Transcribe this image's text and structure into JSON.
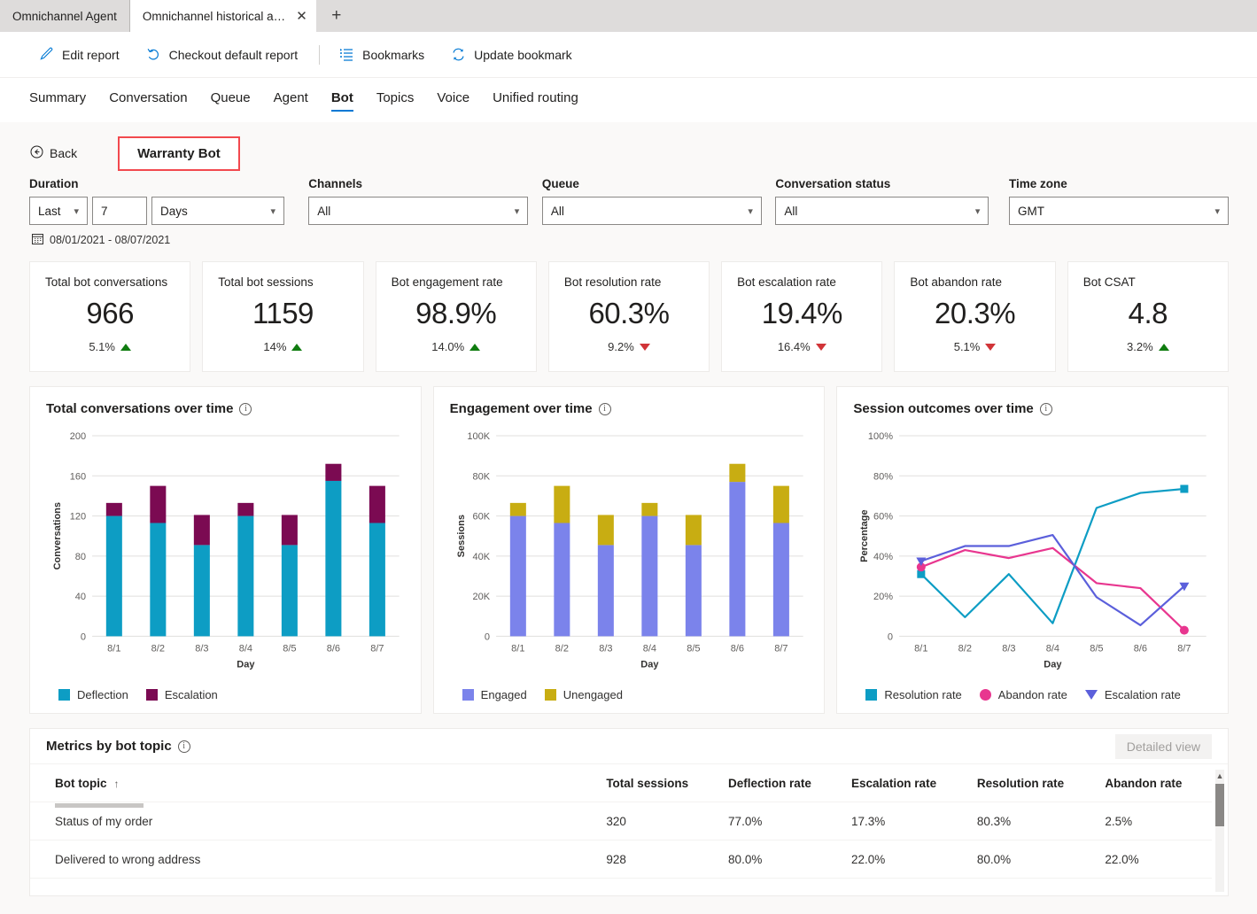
{
  "browser": {
    "tabs": [
      {
        "label": "Omnichannel Agent",
        "active": false
      },
      {
        "label": "Omnichannel historical ana...",
        "active": true
      }
    ],
    "close_glyph": "✕",
    "new_tab_glyph": "+"
  },
  "commandbar": {
    "items": [
      {
        "label": "Edit report",
        "icon": "pencil-icon"
      },
      {
        "label": "Checkout default report",
        "icon": "undo-icon"
      },
      {
        "label": "Bookmarks",
        "icon": "bookmark-list-icon"
      },
      {
        "label": "Update bookmark",
        "icon": "refresh-icon"
      }
    ]
  },
  "navtabs": {
    "items": [
      "Summary",
      "Conversation",
      "Queue",
      "Agent",
      "Bot",
      "Topics",
      "Voice",
      "Unified routing"
    ],
    "selected": "Bot"
  },
  "subheader": {
    "back_label": "Back",
    "bot_name": "Warranty Bot",
    "highlight_color": "#f2494e"
  },
  "filters": {
    "duration": {
      "label": "Duration",
      "mode": "Last",
      "count": "7",
      "unit": "Days"
    },
    "channels": {
      "label": "Channels",
      "value": "All"
    },
    "queue": {
      "label": "Queue",
      "value": "All"
    },
    "conversation_status": {
      "label": "Conversation status",
      "value": "All"
    },
    "time_zone": {
      "label": "Time zone",
      "value": "GMT"
    },
    "date_range": "08/01/2021 - 08/07/2021"
  },
  "kpis": [
    {
      "title": "Total bot conversations",
      "value": "966",
      "delta": "5.1%",
      "dir": "up"
    },
    {
      "title": "Total bot sessions",
      "value": "1159",
      "delta": "14%",
      "dir": "up"
    },
    {
      "title": "Bot engagement rate",
      "value": "98.9%",
      "delta": "14.0%",
      "dir": "up"
    },
    {
      "title": "Bot resolution rate",
      "value": "60.3%",
      "delta": "9.2%",
      "dir": "down"
    },
    {
      "title": "Bot escalation rate",
      "value": "19.4%",
      "delta": "16.4%",
      "dir": "down"
    },
    {
      "title": "Bot abandon rate",
      "value": "20.3%",
      "delta": "5.1%",
      "dir": "down"
    },
    {
      "title": "Bot CSAT",
      "value": "4.8",
      "delta": "3.2%",
      "dir": "up"
    }
  ],
  "colors": {
    "deflection": "#0d9dc4",
    "escalation_bar": "#7b0a52",
    "engaged": "#7b83eb",
    "unengaged": "#c8ad12",
    "resolution_line": "#0d9dc4",
    "abandon_line": "#e8368f",
    "escalation_line": "#5b5fdb",
    "accent": "#0078d4",
    "positive": "#107c10",
    "negative": "#d13438"
  },
  "chart_data": [
    {
      "type": "bar",
      "stacked": true,
      "title": "Total conversations over time",
      "xlabel": "Day",
      "ylabel": "Conversations",
      "ylim": [
        0,
        200
      ],
      "yticks": [
        0,
        40,
        80,
        120,
        160,
        200
      ],
      "grid": true,
      "legend": "bottom-left",
      "categories": [
        "8/1",
        "8/2",
        "8/3",
        "8/4",
        "8/5",
        "8/6",
        "8/7"
      ],
      "series": [
        {
          "name": "Deflection",
          "values": [
            120,
            113,
            91,
            120,
            91,
            155,
            113
          ]
        },
        {
          "name": "Escalation",
          "values": [
            13,
            37,
            30,
            13,
            30,
            17,
            37
          ]
        }
      ]
    },
    {
      "type": "bar",
      "stacked": true,
      "title": "Engagement over time",
      "xlabel": "Day",
      "ylabel": "Sessions",
      "ylim": [
        0,
        100000
      ],
      "yticks": [
        0,
        20000,
        40000,
        60000,
        80000,
        100000
      ],
      "ytick_labels": [
        "0",
        "20K",
        "40K",
        "60K",
        "80K",
        "100K"
      ],
      "grid": true,
      "legend": "bottom-left",
      "categories": [
        "8/1",
        "8/2",
        "8/3",
        "8/4",
        "8/5",
        "8/6",
        "8/7"
      ],
      "series": [
        {
          "name": "Engaged",
          "values": [
            60000,
            56500,
            45500,
            60000,
            45500,
            77000,
            56500
          ]
        },
        {
          "name": "Unengaged",
          "values": [
            6500,
            18500,
            15000,
            6500,
            15000,
            9000,
            18500
          ]
        }
      ]
    },
    {
      "type": "line",
      "title": "Session outcomes over time",
      "xlabel": "Day",
      "ylabel": "Percentage",
      "ylim": [
        0,
        100
      ],
      "yticks": [
        0,
        20,
        40,
        60,
        80,
        100
      ],
      "ytick_labels": [
        "0",
        "20%",
        "40%",
        "60%",
        "80%",
        "100%"
      ],
      "grid": true,
      "legend": "bottom-left",
      "categories": [
        "8/1",
        "8/2",
        "8/3",
        "8/4",
        "8/5",
        "8/6",
        "8/7"
      ],
      "series": [
        {
          "name": "Resolution rate",
          "marker": "square",
          "values": [
            31,
            9.5,
            31,
            6.5,
            64,
            71.5,
            73.5
          ]
        },
        {
          "name": "Abandon rate",
          "marker": "circle",
          "values": [
            34.5,
            43,
            39,
            44,
            26.5,
            24,
            3
          ]
        },
        {
          "name": "Escalation rate",
          "marker": "triangle",
          "values": [
            37.5,
            45,
            45,
            50.5,
            19.5,
            5.5,
            25
          ]
        }
      ]
    }
  ],
  "table": {
    "title": "Metrics by bot topic",
    "detailed_view_label": "Detailed view",
    "sort_column": "Bot topic",
    "sort_arrow": "↑",
    "columns": [
      "Bot topic",
      "Total sessions",
      "Deflection rate",
      "Escalation rate",
      "Resolution rate",
      "Abandon rate"
    ],
    "rows": [
      {
        "topic": "Status of my order",
        "total_sessions": "320",
        "deflection_rate": "77.0%",
        "escalation_rate": "17.3%",
        "resolution_rate": "80.3%",
        "abandon_rate": "2.5%"
      },
      {
        "topic": "Delivered to wrong address",
        "total_sessions": "928",
        "deflection_rate": "80.0%",
        "escalation_rate": "22.0%",
        "resolution_rate": "80.0%",
        "abandon_rate": "22.0%"
      }
    ]
  }
}
